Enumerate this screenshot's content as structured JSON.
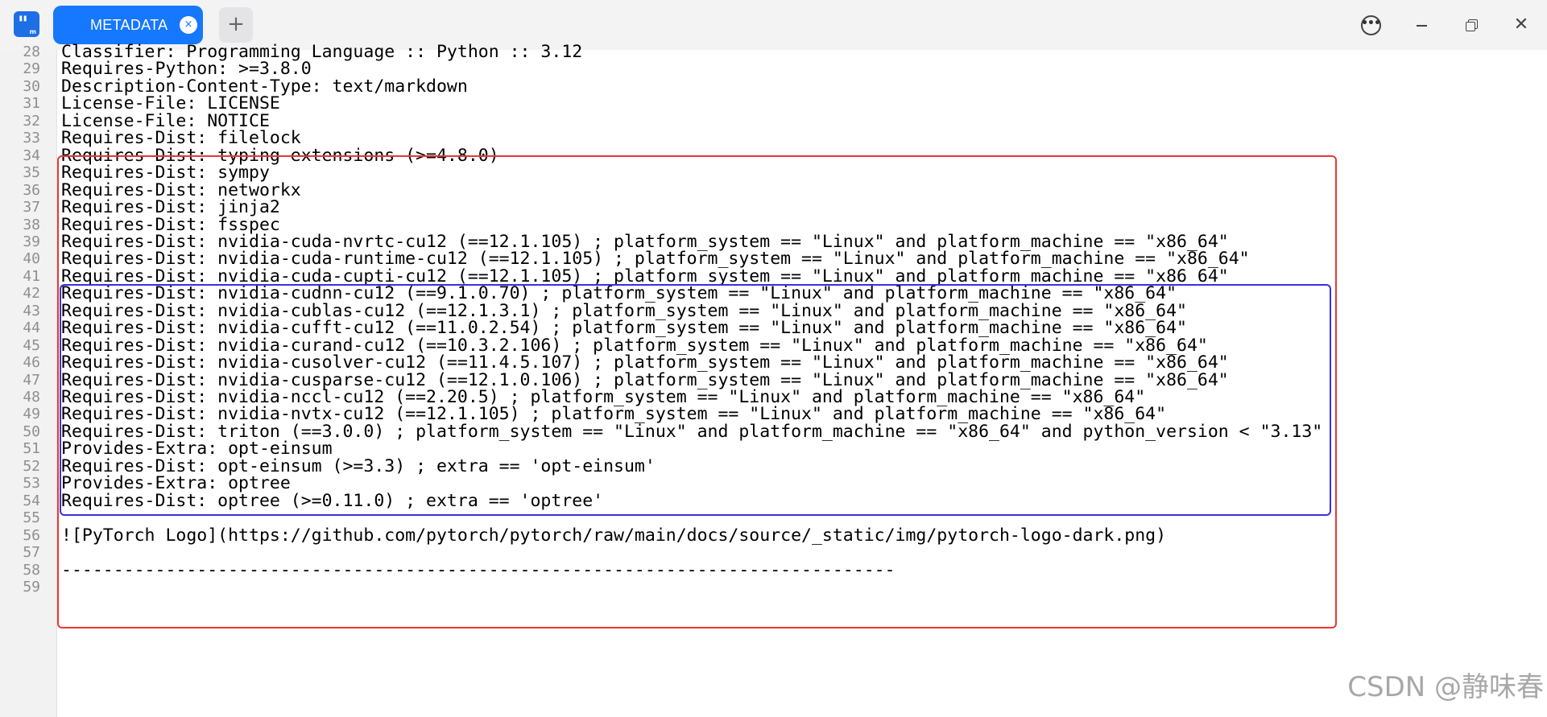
{
  "tab": {
    "title": "METADATA",
    "close_icon": "×"
  },
  "new_tab_icon": "+",
  "window_controls": {
    "more": "•••",
    "close": "✕"
  },
  "editor": {
    "lines": [
      {
        "num": "28",
        "text": "Classifier: Programming Language :: Python :: 3.12"
      },
      {
        "num": "29",
        "text": "Requires-Python: >=3.8.0"
      },
      {
        "num": "30",
        "text": "Description-Content-Type: text/markdown"
      },
      {
        "num": "31",
        "text": "License-File: LICENSE"
      },
      {
        "num": "32",
        "text": "License-File: NOTICE"
      },
      {
        "num": "33",
        "text": "Requires-Dist: filelock"
      },
      {
        "num": "34",
        "text": "Requires-Dist: typing-extensions (>=4.8.0)"
      },
      {
        "num": "35",
        "text": "Requires-Dist: sympy"
      },
      {
        "num": "36",
        "text": "Requires-Dist: networkx"
      },
      {
        "num": "37",
        "text": "Requires-Dist: jinja2"
      },
      {
        "num": "38",
        "text": "Requires-Dist: fsspec"
      },
      {
        "num": "39",
        "text": "Requires-Dist: nvidia-cuda-nvrtc-cu12 (==12.1.105) ; platform_system == \"Linux\" and platform_machine == \"x86_64\""
      },
      {
        "num": "40",
        "text": "Requires-Dist: nvidia-cuda-runtime-cu12 (==12.1.105) ; platform_system == \"Linux\" and platform_machine == \"x86_64\""
      },
      {
        "num": "41",
        "text": "Requires-Dist: nvidia-cuda-cupti-cu12 (==12.1.105) ; platform_system == \"Linux\" and platform_machine == \"x86_64\""
      },
      {
        "num": "42",
        "text": "Requires-Dist: nvidia-cudnn-cu12 (==9.1.0.70) ; platform_system == \"Linux\" and platform_machine == \"x86_64\""
      },
      {
        "num": "43",
        "text": "Requires-Dist: nvidia-cublas-cu12 (==12.1.3.1) ; platform_system == \"Linux\" and platform_machine == \"x86_64\""
      },
      {
        "num": "44",
        "text": "Requires-Dist: nvidia-cufft-cu12 (==11.0.2.54) ; platform_system == \"Linux\" and platform_machine == \"x86_64\""
      },
      {
        "num": "45",
        "text": "Requires-Dist: nvidia-curand-cu12 (==10.3.2.106) ; platform_system == \"Linux\" and platform_machine == \"x86_64\""
      },
      {
        "num": "46",
        "text": "Requires-Dist: nvidia-cusolver-cu12 (==11.4.5.107) ; platform_system == \"Linux\" and platform_machine == \"x86_64\""
      },
      {
        "num": "47",
        "text": "Requires-Dist: nvidia-cusparse-cu12 (==12.1.0.106) ; platform_system == \"Linux\" and platform_machine == \"x86_64\""
      },
      {
        "num": "48",
        "text": "Requires-Dist: nvidia-nccl-cu12 (==2.20.5) ; platform_system == \"Linux\" and platform_machine == \"x86_64\""
      },
      {
        "num": "49",
        "text": "Requires-Dist: nvidia-nvtx-cu12 (==12.1.105) ; platform_system == \"Linux\" and platform_machine == \"x86_64\""
      },
      {
        "num": "50",
        "text": "Requires-Dist: triton (==3.0.0) ; platform_system == \"Linux\" and platform_machine == \"x86_64\" and python_version < \"3.13\""
      },
      {
        "num": "51",
        "text": "Provides-Extra: opt-einsum"
      },
      {
        "num": "52",
        "text": "Requires-Dist: opt-einsum (>=3.3) ; extra == 'opt-einsum'"
      },
      {
        "num": "53",
        "text": "Provides-Extra: optree"
      },
      {
        "num": "54",
        "text": "Requires-Dist: optree (>=0.11.0) ; extra == 'optree'"
      },
      {
        "num": "55",
        "text": ""
      },
      {
        "num": "56",
        "text": "![PyTorch Logo](https://github.com/pytorch/pytorch/raw/main/docs/source/_static/img/pytorch-logo-dark.png)"
      },
      {
        "num": "57",
        "text": ""
      },
      {
        "num": "58",
        "text": "--------------------------------------------------------------------------------"
      },
      {
        "num": "59",
        "text": ""
      }
    ]
  },
  "highlight_colors": {
    "outer_box": "#e53935",
    "inner_box": "#3a2fe0"
  },
  "accent_color": "#1677ff",
  "watermark": "CSDN @静味春"
}
